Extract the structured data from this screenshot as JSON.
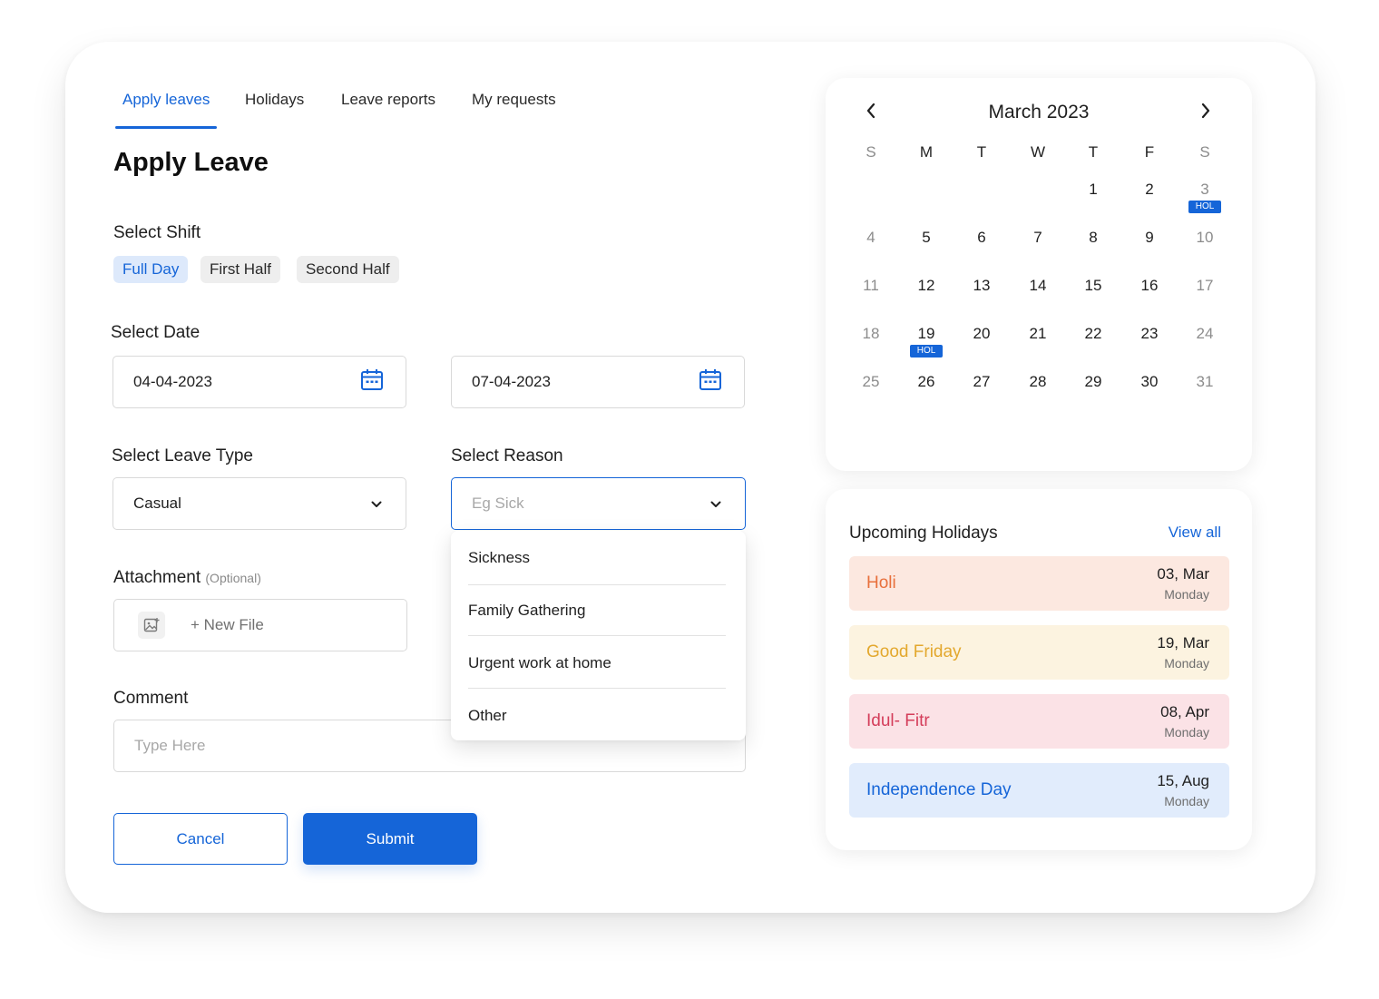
{
  "tabs": [
    {
      "label": "Apply leaves",
      "active": true
    },
    {
      "label": "Holidays"
    },
    {
      "label": "Leave reports"
    },
    {
      "label": "My requests"
    }
  ],
  "page_title": "Apply Leave",
  "shift": {
    "label": "Select Shift",
    "options": [
      "Full Day",
      "First Half",
      "Second Half"
    ],
    "selected": "Full Day"
  },
  "date": {
    "label": "Select Date",
    "from": "04-04-2023",
    "to": "07-04-2023"
  },
  "leave_type": {
    "label": "Select Leave Type",
    "value": "Casual"
  },
  "reason": {
    "label": "Select Reason",
    "placeholder": "Eg Sick",
    "options": [
      "Sickness",
      "Family Gathering",
      "Urgent work at home",
      "Other"
    ]
  },
  "attachment": {
    "label": "Attachment",
    "optional": "(Optional)",
    "new_file": "+ New File"
  },
  "comment": {
    "label": "Comment",
    "placeholder": "Type Here"
  },
  "buttons": {
    "cancel": "Cancel",
    "submit": "Submit"
  },
  "calendar": {
    "title": "March 2023",
    "weekdays": [
      "S",
      "M",
      "T",
      "W",
      "T",
      "F",
      "S"
    ],
    "first_weekday_index": 3,
    "days_in_month": 31,
    "holiday_days": [
      3,
      19
    ],
    "holiday_badge": "HOL"
  },
  "upcoming": {
    "title": "Upcoming Holidays",
    "view_all": "View all",
    "items": [
      {
        "name": "Holi",
        "date": "03, Mar",
        "day": "Monday",
        "bg": "#fce8e0",
        "color": "#e8703c"
      },
      {
        "name": "Good Friday",
        "date": "19, Mar",
        "day": "Monday",
        "bg": "#fcf3e0",
        "color": "#e3a82e"
      },
      {
        "name": "Idul- Fitr",
        "date": "08, Apr",
        "day": "Monday",
        "bg": "#fbe2e6",
        "color": "#d43d5a"
      },
      {
        "name": "Independence Day",
        "date": "15, Aug",
        "day": "Monday",
        "bg": "#e1ecfc",
        "color": "#1565d8"
      }
    ]
  },
  "colors": {
    "accent": "#1565d8"
  }
}
